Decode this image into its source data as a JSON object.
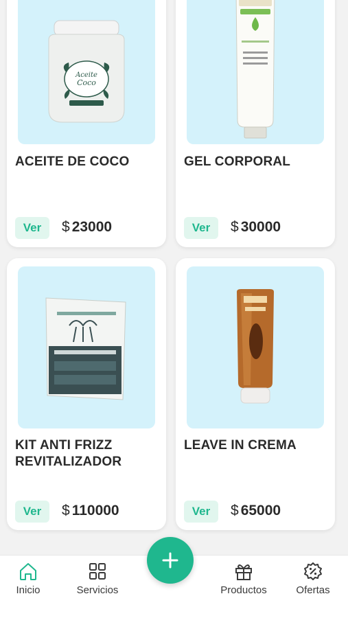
{
  "products": [
    {
      "name": "ACEITE DE COCO",
      "currency": "$",
      "price": "23000",
      "button": "Ver",
      "image": "coconut-oil-jar-icon"
    },
    {
      "name": "GEL CORPORAL",
      "currency": "$",
      "price": "30000",
      "button": "Ver",
      "image": "gel-tube-icon"
    },
    {
      "name": "KIT ANTI FRIZZ REVITALIZADOR",
      "currency": "$",
      "price": "110000",
      "button": "Ver",
      "image": "kit-box-icon"
    },
    {
      "name": "LEAVE IN CREMA",
      "currency": "$",
      "price": "65000",
      "button": "Ver",
      "image": "cream-tube-icon"
    }
  ],
  "nav": {
    "items": [
      {
        "label": "Inicio",
        "icon": "home-icon"
      },
      {
        "label": "Servicios",
        "icon": "grid-icon"
      },
      {
        "label": "Productos",
        "icon": "gift-icon"
      },
      {
        "label": "Ofertas",
        "icon": "discount-badge-icon"
      }
    ],
    "fab_icon": "plus-icon"
  },
  "colors": {
    "accent": "#1fb78e",
    "image_bg": "#d4f2fb",
    "ver_bg": "#e1f6ee",
    "text": "#2a2a2a"
  }
}
